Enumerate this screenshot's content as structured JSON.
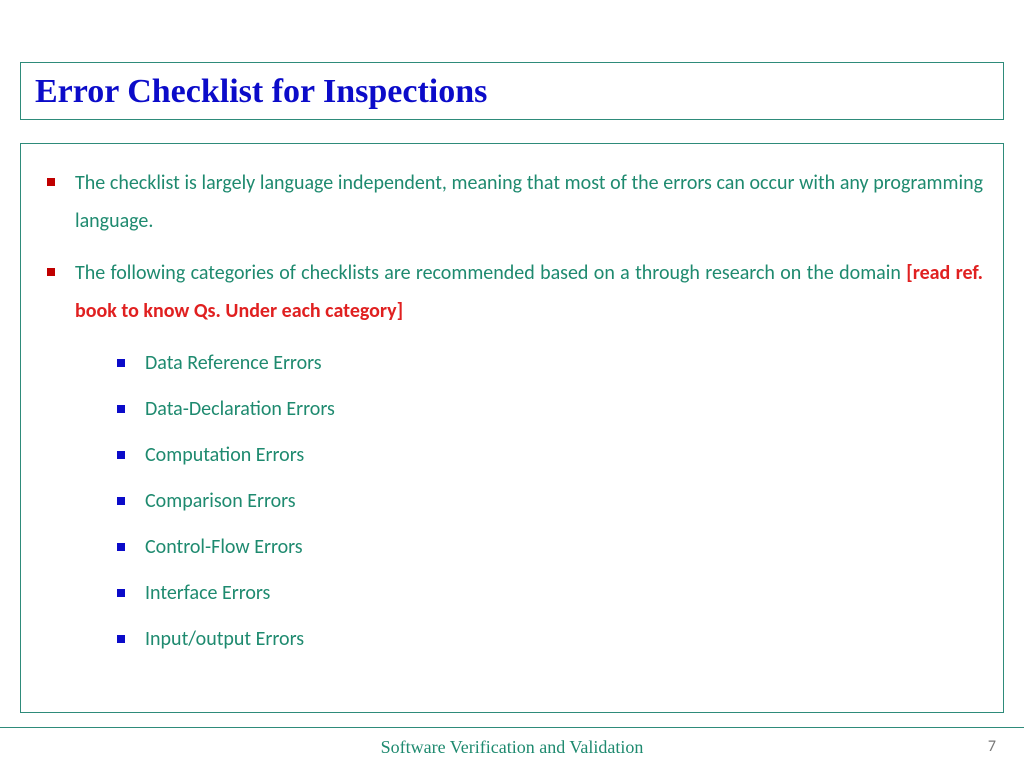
{
  "title": "Error Checklist for Inspections",
  "bullets": {
    "b1": "The checklist is  largely language independent, meaning that most of the errors can occur with any programming language.",
    "b2_pre": "The following categories of checklists are recommended based on a through research on the domain ",
    "b2_ref": "[read ref. book to know Qs. Under each category]"
  },
  "categories": [
    "Data Reference Errors",
    "Data-Declaration Errors",
    "Computation Errors",
    "Comparison Errors",
    "Control-Flow Errors",
    "Interface Errors",
    "Input/output Errors"
  ],
  "footer": "Software Verification and Validation",
  "page": "7"
}
